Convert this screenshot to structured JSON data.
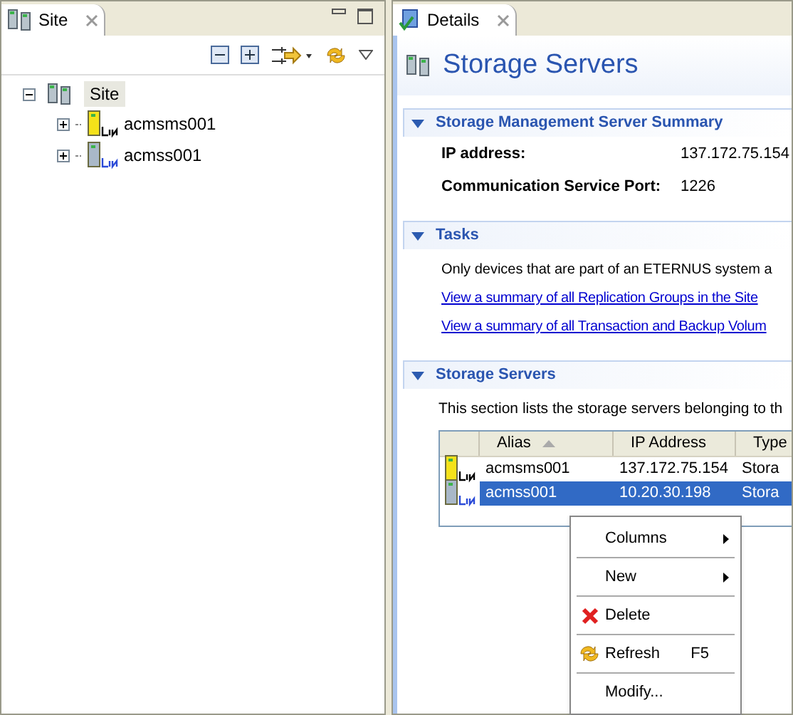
{
  "site_view": {
    "tab": {
      "label": "Site"
    },
    "tree": {
      "label": "Site",
      "expanded": true,
      "selected": true,
      "children": [
        {
          "label": "acmsms001",
          "kind": "manager",
          "expanded": false
        },
        {
          "label": "acmss001",
          "kind": "agent",
          "expanded": false
        }
      ]
    }
  },
  "details_view": {
    "tab": {
      "label": "Details"
    },
    "title": "Storage Servers",
    "sections": [
      {
        "kind": "fields",
        "title": "Storage Management Server Summary",
        "expanded": true,
        "fields": [
          {
            "label": "IP address:",
            "value": "137.172.75.154"
          },
          {
            "label": "Communication Service Port:",
            "value": "1226"
          }
        ]
      },
      {
        "kind": "links",
        "title": "Tasks",
        "expanded": true,
        "text": "Only devices that are part of an ETERNUS system a",
        "links": [
          "View a summary of all Replication Groups in the Site",
          "View a summary of all Transaction and Backup Volum"
        ]
      },
      {
        "kind": "table",
        "title": "Storage Servers",
        "expanded": true,
        "text": "This section lists the storage servers belonging to th",
        "columns": [
          {
            "label": "Alias",
            "sorted": true
          },
          {
            "label": "IP Address",
            "sorted": false
          },
          {
            "label": "Type",
            "sorted": false
          }
        ],
        "rows": [
          {
            "kind": "manager",
            "alias": "acmsms001",
            "ip": "137.172.75.154",
            "type": "Stora",
            "selected": false
          },
          {
            "kind": "agent",
            "alias": "acmss001",
            "ip": "10.20.30.198",
            "type": "Stora",
            "selected": true
          }
        ]
      }
    ]
  },
  "context_menu": {
    "items": [
      {
        "kind": "submenu",
        "label": "Columns"
      },
      {
        "kind": "submenu",
        "label": "New"
      },
      {
        "kind": "delete",
        "label": "Delete"
      },
      {
        "kind": "refresh",
        "label": "Refresh",
        "shortcut": "F5"
      },
      {
        "kind": "plain",
        "label": "Modify..."
      }
    ]
  }
}
